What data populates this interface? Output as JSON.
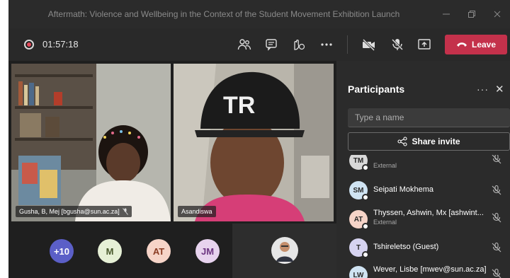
{
  "window": {
    "title": "Aftermath: Violence and Wellbeing in the Context of the Student Movement Exhibition Launch"
  },
  "toolbar": {
    "timer": "01:57:18",
    "leave_label": "Leave",
    "icons": [
      "participants-icon",
      "chat-icon",
      "raise-hand-icon",
      "more-icon",
      "camera-off-icon",
      "mic-off-icon",
      "share-screen-icon"
    ]
  },
  "stage": {
    "tiles": [
      {
        "name": "Gusha, B, Mej [bgusha@sun.ac.za]"
      },
      {
        "name": "Asandiswa"
      }
    ],
    "avatars": [
      {
        "initials": "+10",
        "color": "#5b5fc7",
        "text_color": "#ffffff"
      },
      {
        "initials": "M",
        "color": "#e6f0d6",
        "text_color": "#4a5a2e"
      },
      {
        "initials": "AT",
        "color": "#f6d4c8",
        "text_color": "#8a3b23"
      },
      {
        "initials": "JM",
        "color": "#e7d3ee",
        "text_color": "#6b3480"
      }
    ]
  },
  "panel": {
    "title": "Participants",
    "search_placeholder": "Type a name",
    "share_label": "Share invite",
    "participants": [
      {
        "initials": "TM",
        "name": "",
        "sub": "External",
        "color": "#d8d8d8"
      },
      {
        "initials": "SM",
        "name": "Seipati Mokhema",
        "sub": "",
        "color": "#cfe3f2"
      },
      {
        "initials": "AT",
        "name": "Thyssen, Ashwin, Mx [ashwint...",
        "sub": "External",
        "color": "#f6d4c8"
      },
      {
        "initials": "T",
        "name": "Tshireletso (Guest)",
        "sub": "",
        "color": "#d6d3f0"
      },
      {
        "initials": "LW",
        "name": "Wever, Lisbe [mwev@sun.ac.za]",
        "sub": "",
        "color": "#cfe3f2"
      }
    ]
  },
  "colors": {
    "leave": "#c4314b",
    "background": "#1f1f1f",
    "panel": "#2b2b2b"
  }
}
